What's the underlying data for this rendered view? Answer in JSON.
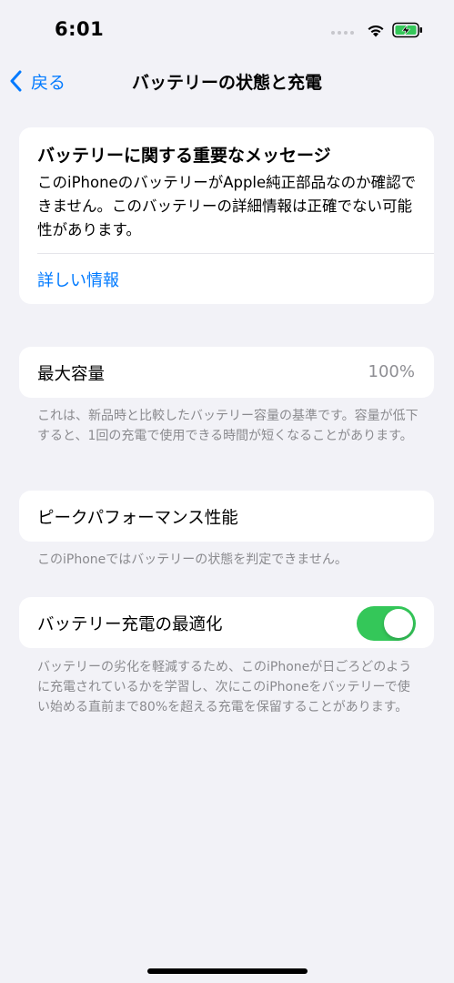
{
  "status_bar": {
    "time": "6:01",
    "charging": true
  },
  "nav": {
    "back_label": "戻る",
    "title": "バッテリーの状態と充電"
  },
  "message": {
    "title": "バッテリーに関する重要なメッセージ",
    "body": "このiPhoneのバッテリーがApple純正部品なのか確認できません。このバッテリーの詳細情報は正確でない可能性があります。",
    "link": "詳しい情報"
  },
  "max_capacity": {
    "label": "最大容量",
    "value": "100%",
    "footnote": "これは、新品時と比較したバッテリー容量の基準です。容量が低下すると、1回の充電で使用できる時間が短くなることがあります。"
  },
  "peak_performance": {
    "label": "ピークパフォーマンス性能",
    "footnote": "このiPhoneではバッテリーの状態を判定できません。"
  },
  "optimized_charging": {
    "label": "バッテリー充電の最適化",
    "enabled": true,
    "footnote": "バッテリーの劣化を軽減するため、このiPhoneが日ごろどのように充電されているかを学習し、次にこのiPhoneをバッテリーで使い始める直前まで80%を超える充電を保留することがあります。"
  },
  "colors": {
    "accent": "#007aff",
    "toggle_on": "#34c759",
    "background": "#f2f2f7",
    "secondary_text": "#8a8a8e"
  },
  "icons": [
    "wifi-icon",
    "battery-charging-icon",
    "back-chevron-icon"
  ]
}
